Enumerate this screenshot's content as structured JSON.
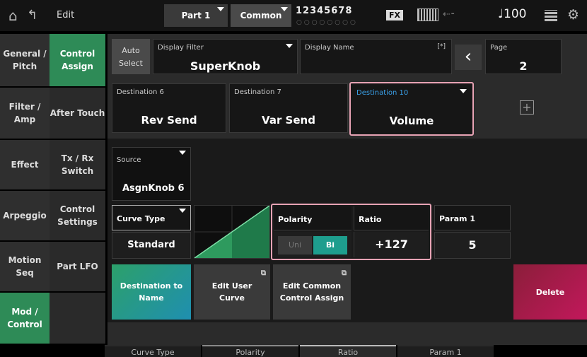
{
  "header": {
    "title": "Edit",
    "part_button": "Part 1",
    "common_button": "Common",
    "part_numbers": "12345678",
    "part_dots": "○○○○○○○○",
    "fx_badge": "FX",
    "tempo": "♩100"
  },
  "sidebar_main": [
    {
      "label": "General / Pitch"
    },
    {
      "label": "Filter / Amp"
    },
    {
      "label": "Effect"
    },
    {
      "label": "Arpeggio"
    },
    {
      "label": "Motion Seq"
    },
    {
      "label": "Mod / Control"
    }
  ],
  "sidebar_sub": [
    {
      "label": "Control Assign"
    },
    {
      "label": "After Touch"
    },
    {
      "label": "Tx / Rx Switch"
    },
    {
      "label": "Control Settings"
    },
    {
      "label": "Part LFO"
    }
  ],
  "topbar": {
    "auto_select": "Auto Select",
    "display_filter_label": "Display Filter",
    "display_filter_value": "SuperKnob",
    "display_name_label": "Display Name",
    "display_name_marker": "[*]",
    "page_label": "Page",
    "page_value": "2"
  },
  "destinations": [
    {
      "label": "Destination 6",
      "value": "Rev Send"
    },
    {
      "label": "Destination 7",
      "value": "Var Send"
    },
    {
      "label": "Destination 10",
      "value": "Volume"
    }
  ],
  "add_destination": "+",
  "source": {
    "label": "Source",
    "value": "AsgnKnob 6"
  },
  "curve": {
    "label": "Curve Type",
    "value": "Standard"
  },
  "polarity": {
    "label": "Polarity",
    "option_uni": "Uni",
    "option_bi": "Bi",
    "selected": "Bi"
  },
  "ratio": {
    "label": "Ratio",
    "value": "+127"
  },
  "param1": {
    "label": "Param 1",
    "value": "5"
  },
  "actions": {
    "dest_to_name": "Destination to Name",
    "edit_user_curve": "Edit User Curve",
    "edit_common": "Edit Common Control Assign",
    "delete": "Delete"
  },
  "bottom_tabs": [
    "Curve Type",
    "Polarity",
    "Ratio",
    "Param 1"
  ],
  "colors": {
    "accent": "#2e8b57",
    "highlight": "#e8a3b5",
    "link": "#3aa0e8",
    "delete": "#c2185b"
  }
}
